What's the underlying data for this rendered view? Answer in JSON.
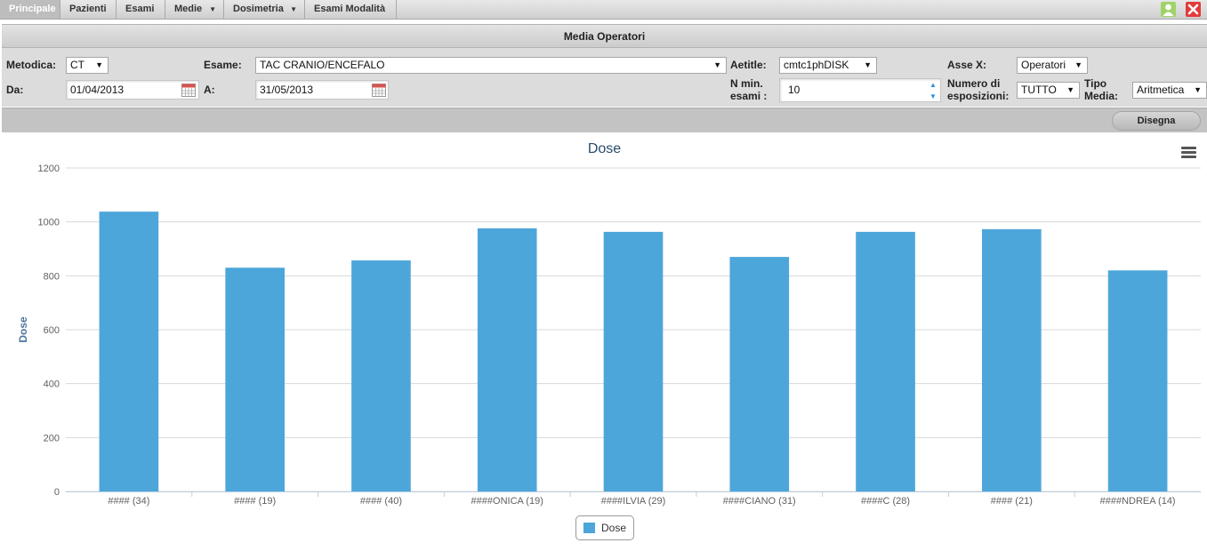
{
  "menu": {
    "items": [
      {
        "label": "Principale",
        "active": true
      },
      {
        "label": "Pazienti"
      },
      {
        "label": "Esami"
      },
      {
        "label": "Medie",
        "dropdown": true
      },
      {
        "label": "Dosimetria",
        "dropdown": true
      },
      {
        "label": "Esami Modalità"
      }
    ],
    "icons": [
      "user-icon",
      "close-icon"
    ]
  },
  "panel": {
    "title": "Media Operatori"
  },
  "form": {
    "metodica": {
      "label": "Metodica:",
      "value": "CT"
    },
    "esame": {
      "label": "Esame:",
      "value": "TAC CRANIO/ENCEFALO"
    },
    "aetitle": {
      "label": "Aetitle:",
      "value": "cmtc1phDISK"
    },
    "asse_x": {
      "label": "Asse X:",
      "value": "Operatori"
    },
    "da": {
      "label": "Da:",
      "value": "01/04/2013"
    },
    "a": {
      "label": "A:",
      "value": "31/05/2013"
    },
    "n_min": {
      "label_line1": "N min.",
      "label_line2": "esami :",
      "value": "10"
    },
    "numero_esposizioni": {
      "label_line1": "Numero di",
      "label_line2": "esposizioni:",
      "value": "TUTTO"
    },
    "tipo_media": {
      "label_line1": "Tipo",
      "label_line2": "Media:",
      "value": "Aritmetica"
    },
    "draw_button": "Disegna"
  },
  "colors": {
    "bar": "#4da6da",
    "title": "#274b6d",
    "grid": "#d8d8d8"
  },
  "chart_data": {
    "type": "bar",
    "title": "Dose",
    "xlabel": "",
    "ylabel": "Dose",
    "ylim": [
      0,
      1200
    ],
    "yticks": [
      0,
      200,
      400,
      600,
      800,
      1000,
      1200
    ],
    "grid": true,
    "legend_position": "bottom-center",
    "categories": [
      "#### (34)",
      "#### (19)",
      "#### (40)",
      "####ONICA (19)",
      "####ILVIA (29)",
      "####CIANO (31)",
      "####C (28)",
      "#### (21)",
      "####NDREA (14)"
    ],
    "series": [
      {
        "name": "Dose",
        "values": [
          1038,
          830,
          857,
          976,
          963,
          870,
          963,
          973,
          820
        ]
      }
    ]
  }
}
